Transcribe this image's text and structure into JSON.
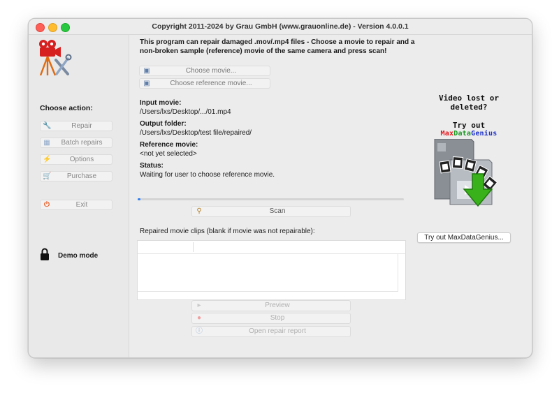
{
  "window": {
    "title": "Copyright 2011-2024 by Grau GmbH (www.grauonline.de) - Version 4.0.0.1"
  },
  "sidebar": {
    "choose_action_label": "Choose action:",
    "buttons": [
      {
        "label": "Repair",
        "icon": "wrench-icon"
      },
      {
        "label": "Batch repairs",
        "icon": "batch-icon"
      },
      {
        "label": "Options",
        "icon": "lightning-icon"
      },
      {
        "label": "Purchase",
        "icon": "cart-icon"
      },
      {
        "label": "Exit",
        "icon": "power-icon"
      }
    ],
    "demo_mode_label": "Demo mode"
  },
  "main": {
    "intro_text": "This program can repair damaged .mov/.mp4 files - Choose a movie to repair and a non-broken sample (reference) movie of the same camera and press scan!",
    "choose_movie_label": "Choose movie...",
    "choose_reference_label": "Choose reference movie...",
    "input_movie": {
      "heading": "Input movie:",
      "value": "/Users/lxs/Desktop/.../01.mp4"
    },
    "output_folder": {
      "heading": "Output folder:",
      "value": "/Users/lxs/Desktop/test file/repaired/"
    },
    "reference_movie": {
      "heading": "Reference movie:",
      "value": "<not yet selected>"
    },
    "status": {
      "heading": "Status:",
      "value": "Waiting for user to choose reference movie."
    },
    "progress_fraction": 0.01,
    "scan_label": "Scan",
    "clips_label": "Repaired movie clips (blank if movie was not repairable):",
    "preview_label": "Preview",
    "stop_label": "Stop",
    "open_report_label": "Open repair report"
  },
  "promo": {
    "title": "Video lost or deleted?",
    "try_out_label": "Try out",
    "brand_parts": [
      {
        "text": "Max",
        "color": "#e8161b"
      },
      {
        "text": "Data",
        "color": "#1a9a23"
      },
      {
        "text": "Genius",
        "color": "#1f33c8"
      }
    ],
    "button_label": "Try out MaxDataGenius..."
  },
  "colors": {
    "accent": "#2f7ff5",
    "traffic_red": "#fe5f57",
    "traffic_yellow": "#febc2e",
    "traffic_green": "#28c840"
  }
}
